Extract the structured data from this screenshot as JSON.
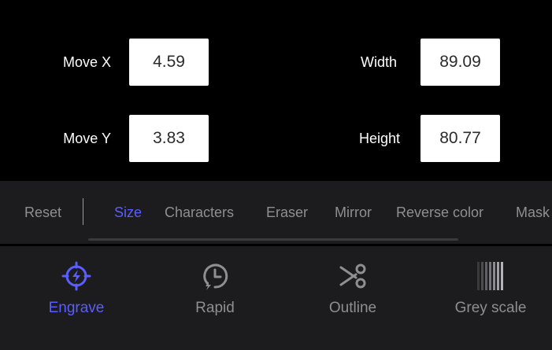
{
  "params": {
    "move_x": {
      "label": "Move X",
      "value": "4.59"
    },
    "move_y": {
      "label": "Move Y",
      "value": "3.83"
    },
    "width": {
      "label": "Width",
      "value": "89.09"
    },
    "height": {
      "label": "Height",
      "value": "80.77"
    }
  },
  "toolbar": {
    "reset": "Reset",
    "items": [
      {
        "label": "Size",
        "active": true
      },
      {
        "label": "Characters",
        "active": false
      },
      {
        "label": "Eraser",
        "active": false
      },
      {
        "label": "Mirror",
        "active": false
      },
      {
        "label": "Reverse color",
        "active": false
      },
      {
        "label": "Mask",
        "active": false
      }
    ]
  },
  "modes": [
    {
      "label": "Engrave",
      "icon": "engrave-icon",
      "active": true
    },
    {
      "label": "Rapid",
      "icon": "rapid-clock-icon",
      "active": false
    },
    {
      "label": "Outline",
      "icon": "scissors-icon",
      "active": false
    },
    {
      "label": "Grey scale",
      "icon": "grey-scale-icon",
      "active": false
    }
  ],
  "colors": {
    "accent": "#5a5dff",
    "inactive": "#8e8e93",
    "panel": "#1c1c1e",
    "background": "#000000"
  }
}
